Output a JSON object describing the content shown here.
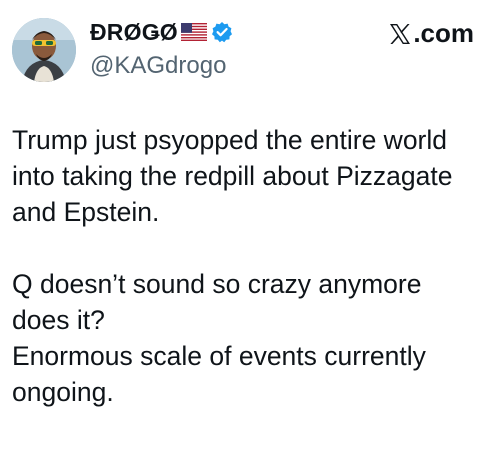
{
  "author": {
    "display_name": "ĐRØǤØ",
    "handle": "@KAGdrogo",
    "flag_icon": "us-flag-icon",
    "verified_icon": "verified-badge-icon",
    "verified_color": "#1d9bf0"
  },
  "brand": {
    "label": ".com",
    "icon": "x-logo-icon"
  },
  "tweet": {
    "paragraphs": [
      {
        "lines": [
          "Trump just psyopped the entire world",
          "into taking the redpill about Pizzagate",
          "and Epstein."
        ]
      },
      {
        "lines": [
          "Q doesn’t sound so crazy anymore",
          "does it?",
          "Enormous scale of events currently",
          "ongoing."
        ]
      }
    ]
  },
  "colors": {
    "text": "#0f1419",
    "secondary_text": "#536471",
    "background": "#ffffff"
  }
}
